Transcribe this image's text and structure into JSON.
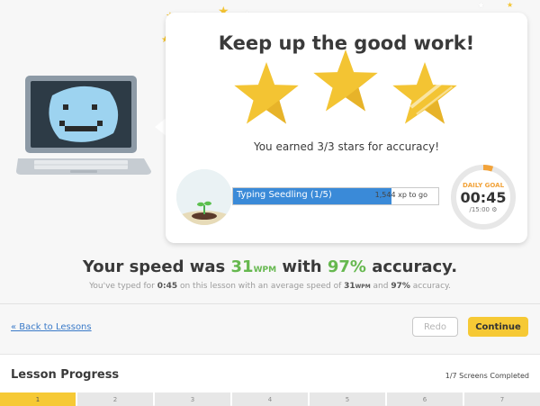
{
  "card": {
    "title": "Keep up the good work!",
    "earned_text": "You earned 3/3 stars for accuracy!",
    "stars": [
      {
        "icon": "star-icon",
        "state": "earned"
      },
      {
        "icon": "star-icon",
        "state": "earned"
      },
      {
        "icon": "star-icon",
        "state": "earned"
      }
    ],
    "level": {
      "label": "Typing Seedling (1/5)",
      "xp_to_go": "1,544 xp to go",
      "progress": 0.77
    },
    "daily_goal": {
      "label": "DAILY GOAL",
      "time": "00:45",
      "goal": "/15:00",
      "progress": 0.05
    }
  },
  "summary": {
    "speed_prefix": "Your speed was ",
    "speed_value": "31",
    "speed_unit": "WPM",
    "speed_mid": " with ",
    "accuracy_value": "97%",
    "speed_suffix": " accuracy.",
    "sub_prefix": "You've typed for ",
    "sub_time": "0:45",
    "sub_mid": " on this lesson with an average speed of ",
    "sub_speed": "31",
    "sub_unit": "WPM",
    "sub_and": " and ",
    "sub_accuracy": "97%",
    "sub_suffix": " accuracy."
  },
  "actions": {
    "back_label": "« Back to Lessons",
    "redo_label": "Redo",
    "continue_label": "Continue"
  },
  "lesson_progress": {
    "title": "Lesson Progress",
    "completed": "1/7 Screens Completed",
    "screens": [
      "1",
      "2",
      "3",
      "4",
      "5",
      "6",
      "7"
    ],
    "current": 1
  },
  "colors": {
    "star": "#f3c433",
    "progress_blue": "#3a8ad8",
    "goal_orange": "#f2a33a",
    "green": "#66b84f",
    "continue_yellow": "#f6c935",
    "link_blue": "#3a7ac8"
  }
}
